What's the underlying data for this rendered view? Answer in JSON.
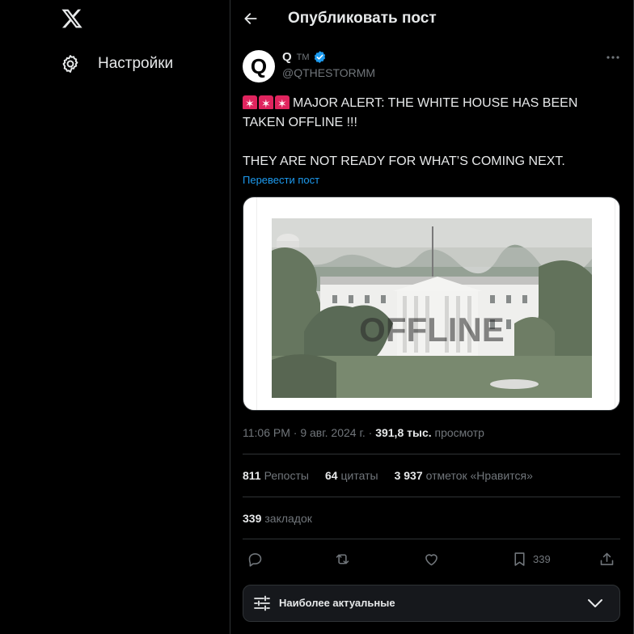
{
  "sidebar": {
    "settings_label": "Настройки"
  },
  "header": {
    "title": "Опубликовать пост"
  },
  "post": {
    "avatar_letter": "Q",
    "author_name": "Q",
    "author_tm": "TM",
    "handle": "@QTHESTORMM",
    "text_line1": "MAJOR ALERT: THE WHITE HOUSE HAS BEEN TAKEN OFFLINE !!!",
    "text_line2": "THEY ARE NOT READY FOR WHAT’S COMING NEXT.",
    "translate_label": "Перевести пост",
    "media_overlay_text": "OFFLINE",
    "time": "11:06 PM",
    "date": "9 авг. 2024 г.",
    "views_count": "391,8 тыс.",
    "views_label": "просмотр"
  },
  "stats": {
    "reposts_count": "811",
    "reposts_label": "Репосты",
    "quotes_count": "64",
    "quotes_label": "цитаты",
    "likes_count": "3 937",
    "likes_label": "отметок «Нравится»",
    "bookmarks_count": "339",
    "bookmarks_label": "закладок"
  },
  "actions": {
    "bookmark_count": "339"
  },
  "sort": {
    "label": "Наиболее актуальные"
  },
  "colors": {
    "background": "#000000",
    "text": "#e7e9ea",
    "muted": "#71767b",
    "accent": "#1d9bf0",
    "divider": "#2f3336",
    "alert_red": "#e0245e"
  },
  "icons": [
    "x-logo-icon",
    "gear-icon",
    "back-arrow-icon",
    "verified-badge-icon",
    "more-icon",
    "siren-icon",
    "reply-icon",
    "repost-icon",
    "like-icon",
    "bookmark-icon",
    "share-icon",
    "tune-icon",
    "chevron-down-icon"
  ]
}
